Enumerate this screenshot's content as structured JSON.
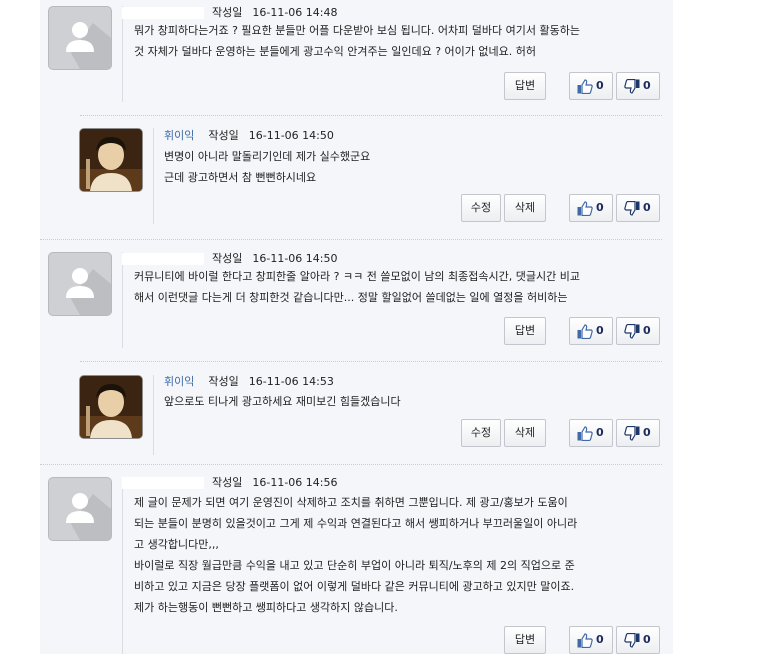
{
  "comments": [
    {
      "author": "",
      "date_label": "작성일",
      "date": "16-11-06 14:48",
      "text": "뭐가 창피하다는거죠 ? 필요한 분들만 어플 다운받아 보심 됩니다. 어차피 덜바다 여기서 활동하는\n것 자체가 덜바다 운영하는 분들에게 광고수익 안겨주는 일인데요 ? 어이가 없네요. 허허",
      "buttons": [
        "답변"
      ],
      "likes": "0",
      "dislikes": "0"
    },
    {
      "author": "휘이익",
      "date_label": "작성일",
      "date": "16-11-06 14:50",
      "text": "변명이 아니라 말돌리기인데 제가 실수했군요\n근데 광고하면서 참 뻔뻔하시네요",
      "buttons": [
        "수정",
        "삭제"
      ],
      "likes": "0",
      "dislikes": "0"
    },
    {
      "author": "",
      "date_label": "작성일",
      "date": "16-11-06 14:50",
      "text": "커뮤니티에 바이럴 한다고 창피한줄 알아라 ? ㅋㅋ 전 쓸모없이 남의 최종접속시간, 댓글시간 비교\n해서 이런댓글 다는게 더 창피한것 같습니다만... 정말 할일없어 쓸데없는 일에 열정을 허비하는",
      "buttons": [
        "답변"
      ],
      "likes": "0",
      "dislikes": "0"
    },
    {
      "author": "휘이익",
      "date_label": "작성일",
      "date": "16-11-06 14:53",
      "text": "앞으로도 티나게 광고하세요 재미보긴 힘들겠습니다",
      "buttons": [
        "수정",
        "삭제"
      ],
      "likes": "0",
      "dislikes": "0"
    },
    {
      "author": "",
      "date_label": "작성일",
      "date": "16-11-06 14:56",
      "text": "제 글이 문제가 되면 여기 운영진이 삭제하고 조치를 취하면 그뿐입니다. 제 광고/홍보가 도움이\n되는 분들이 분명히 있을것이고 그게 제 수익과 연결된다고 해서 쌩피하거나 부끄러울일이 아니라\n고 생각합니다만,,,\n바이럴로 직장 월급만큼 수익을 내고 있고 단순히 부업이 아니라 퇴직/노후의 제 2의 직업으로 준\n비하고 있고 지금은 당장 플랫폼이 없어 이렇게 덜바다 같은 커뮤니티에 광고하고 있지만 말이죠.\n제가 하는행동이 뻔뻔하고 쌩피하다고 생각하지 않습니다.",
      "buttons": [
        "답변"
      ],
      "likes": "0",
      "dislikes": "0"
    }
  ]
}
